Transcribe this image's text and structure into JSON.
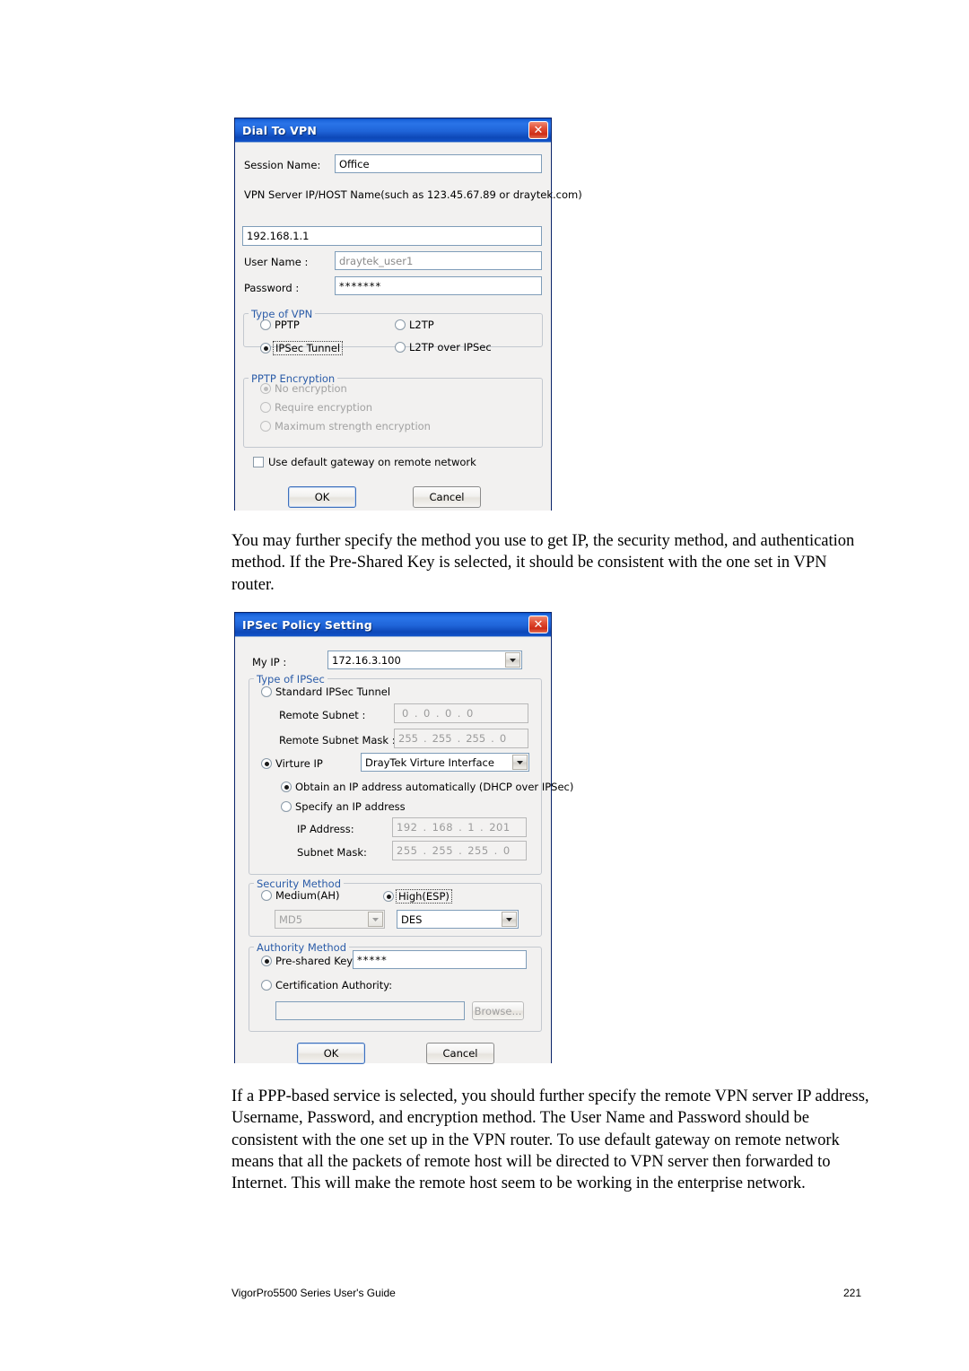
{
  "dialog1": {
    "title": "Dial To VPN",
    "close_label": "✕",
    "session_name_label": "Session Name:",
    "session_name_value": "Office",
    "vpn_server_label": "VPN Server IP/HOST Name(such as 123.45.67.89 or draytek.com)",
    "vpn_server_value": "192.168.1.1",
    "user_name_label": "User Name :",
    "user_name_value": "draytek_user1",
    "password_label": "Password :",
    "password_value": "*******",
    "type_group": "Type of VPN",
    "type_options": [
      {
        "label": "PPTP",
        "checked": false
      },
      {
        "label": "L2TP",
        "checked": false
      },
      {
        "label": "IPSec Tunnel",
        "checked": true,
        "focused": true
      },
      {
        "label": "L2TP over IPSec",
        "checked": false
      }
    ],
    "pptp_group": "PPTP Encryption",
    "pptp_options": [
      {
        "label": "No encryption",
        "checked": true
      },
      {
        "label": "Require encryption",
        "checked": false
      },
      {
        "label": "Maximum strength encryption",
        "checked": false
      }
    ],
    "default_gateway_label": "Use default gateway on remote network",
    "ok_label": "OK",
    "cancel_label": "Cancel"
  },
  "para1": "You may further specify the method you use to get IP, the security method, and authentication method. If the Pre-Shared Key is selected, it should be consistent with the one set in VPN router.",
  "dialog2": {
    "title": "IPSec Policy Setting",
    "close_label": "✕",
    "my_ip_label": "My IP :",
    "my_ip_value": "172.16.3.100",
    "type_group": "Type of IPSec",
    "standard_tunnel_label": "Standard IPSec Tunnel",
    "remote_subnet_label": "Remote Subnet :",
    "remote_subnet_value": [
      "0",
      "0",
      "0",
      "0"
    ],
    "remote_subnet_mask_label": "Remote Subnet Mask :",
    "remote_subnet_mask_value": [
      "255",
      "255",
      "255",
      "0"
    ],
    "virture_ip_label": "Virture IP",
    "virture_ip_value": "DrayTek Virture Interface",
    "obtain_auto_label": "Obtain an IP address automatically (DHCP over IPSec)",
    "specify_ip_label": "Specify an IP address",
    "ip_address_label": "IP Address:",
    "ip_address_value": [
      "192",
      "168",
      "1",
      "201"
    ],
    "subnet_mask_label": "Subnet Mask:",
    "subnet_mask_value": [
      "255",
      "255",
      "255",
      "0"
    ],
    "security_group": "Security Method",
    "medium_label": "Medium(AH)",
    "high_label": "High(ESP)",
    "medium_combo_value": "MD5",
    "high_combo_value": "DES",
    "authority_group": "Authority Method",
    "preshared_label": "Pre-shared Key :",
    "preshared_value": "*****",
    "cert_authority_label": "Certification Authority:",
    "cert_value": "",
    "browse_label": "Browse...",
    "ok_label": "OK",
    "cancel_label": "Cancel"
  },
  "para2": "If a PPP-based service is selected, you should further specify the remote VPN server IP address, Username, Password, and encryption method. The User Name and Password should be consistent with the one set up in the VPN router. To use default gateway on remote network means that all the packets of remote host will be directed to VPN server then forwarded to Internet. This will make the remote host seem to be working in the enterprise network.",
  "footer": {
    "left": "VigorPro5500 Series User's Guide",
    "right": "221"
  }
}
